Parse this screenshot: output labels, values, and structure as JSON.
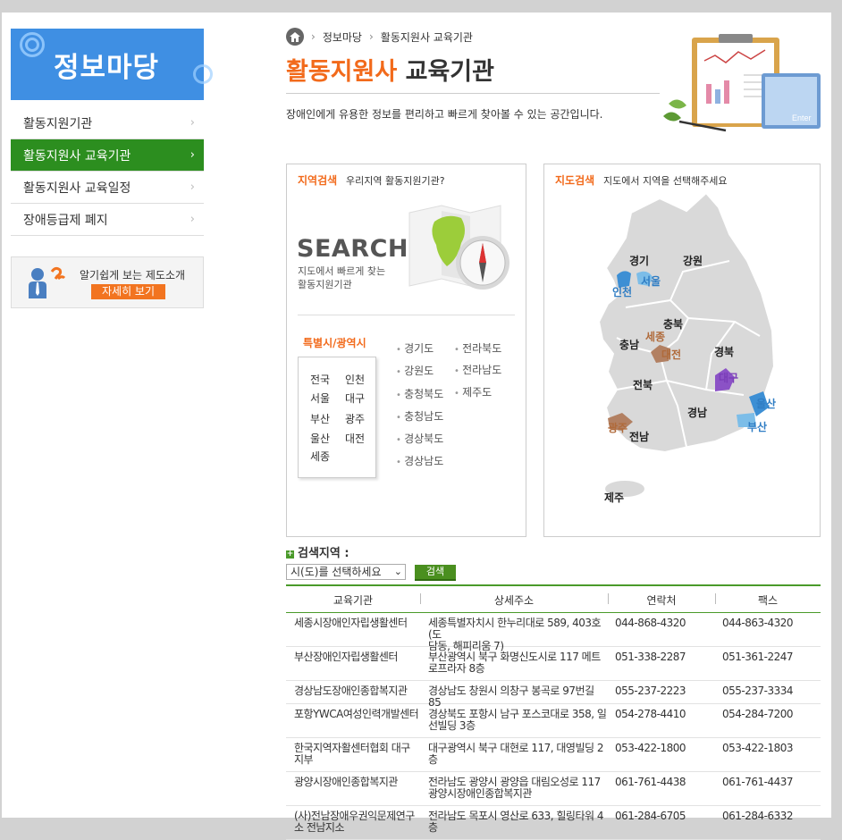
{
  "sidebar": {
    "title": "정보마당",
    "menu": [
      {
        "label": "활동지원기관",
        "active": false
      },
      {
        "label": "활동지원사 교육기관",
        "active": true
      },
      {
        "label": "활동지원사 교육일정",
        "active": false
      },
      {
        "label": "장애등급제 폐지",
        "active": false
      }
    ],
    "promo": {
      "text": "알기쉽게 보는 제도소개",
      "button": "자세히 보기"
    }
  },
  "breadcrumb": [
    "정보마당",
    "활동지원사 교육기관"
  ],
  "page": {
    "title_highlight": "활동지원사",
    "title_rest": "교육기관",
    "description": "장애인에게 유용한 정보를 편리하고 빠르게 찾아볼 수 있는 공간입니다."
  },
  "region_search": {
    "title": "지역검색",
    "subtitle": "우리지역 활동지원기관?",
    "search_word": "SEARCH",
    "search_desc_1": "지도에서 빠르게 찾는",
    "search_desc_2": "활동지원기관",
    "metro_title": "특별시/광역시",
    "metro": [
      "전국",
      "인천",
      "서울",
      "대구",
      "부산",
      "광주",
      "울산",
      "대전",
      "세종"
    ],
    "provinces_col1": [
      "경기도",
      "강원도",
      "충청북도",
      "충청남도",
      "경상북도",
      "경상남도"
    ],
    "provinces_col2": [
      "전라북도",
      "전라남도",
      "제주도"
    ]
  },
  "map_search": {
    "title": "지도검색",
    "subtitle": "지도에서 지역을 선택해주세요",
    "labels": {
      "gyeonggi": "경기",
      "gangwon": "강원",
      "seoul": "서울",
      "incheon": "인천",
      "chungbuk": "충북",
      "sejong": "세종",
      "chungnam": "충남",
      "daejeon": "대전",
      "gyeongbuk": "경북",
      "daegu": "대구",
      "jeonbuk": "전북",
      "ulsan": "울산",
      "gyeongnam": "경남",
      "busan": "부산",
      "gwangju": "광주",
      "jeonnam": "전남",
      "jeju": "제주"
    }
  },
  "search": {
    "label": "검색지역 :",
    "select_value": "시(도)를 선택하세요",
    "button": "검색"
  },
  "table": {
    "headers": [
      "교육기관",
      "상세주소",
      "연락처",
      "팩스"
    ],
    "rows": [
      {
        "name": [
          "세종시장애인자립생활센터"
        ],
        "address": [
          "세종특별자치시 한누리대로 589, 403호(도",
          "담동, 해피리움 7)"
        ],
        "phone": "044-868-4320",
        "fax": "044-863-4320"
      },
      {
        "name": [
          "부산장애인자립생활센터"
        ],
        "address": [
          "부산광역시 북구 화명신도시로 117 메트",
          "로프라자 8층"
        ],
        "phone": "051-338-2287",
        "fax": "051-361-2247"
      },
      {
        "name": [
          "경상남도장애인종합복지관"
        ],
        "address": [
          "경상남도 창원시 의창구 봉곡로 97번길 85"
        ],
        "phone": "055-237-2223",
        "fax": "055-237-3334"
      },
      {
        "name": [
          "포항YWCA여성인력개발센터"
        ],
        "address": [
          "경상북도 포항시 남구 포스코대로 358, 일",
          "선빌딩 3층"
        ],
        "phone": "054-278-4410",
        "fax": "054-284-7200"
      },
      {
        "name": [
          "한국지역자활센터협회 대구",
          "지부"
        ],
        "address": [
          "대구광역시 북구 대현로 117, 대영빌딩 2",
          "층"
        ],
        "phone": "053-422-1800",
        "fax": "053-422-1803"
      },
      {
        "name": [
          "광양시장애인종합복지관"
        ],
        "address": [
          "전라남도 광양시 광양읍 대림오성로 117",
          "광양시장애인종합복지관"
        ],
        "phone": "061-761-4438",
        "fax": "061-761-4437"
      },
      {
        "name": [
          "(사)전남장애우권익문제연구",
          "소 전남지소"
        ],
        "address": [
          "전라남도 목포시 영산로 633, 힐링타워 4",
          "층"
        ],
        "phone": "061-284-6705",
        "fax": "061-284-6332"
      }
    ]
  },
  "colors": {
    "accent_orange": "#f26a1b",
    "accent_green": "#2c8e1f",
    "header_blue": "#3f8fe3"
  }
}
